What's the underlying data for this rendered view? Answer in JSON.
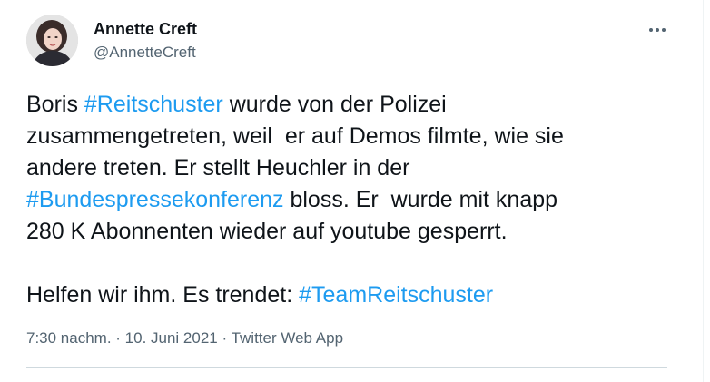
{
  "author": {
    "name": "Annette Creft",
    "handle": "@AnnetteCreft"
  },
  "tweet": {
    "line1": {
      "pre": "Boris ",
      "tag": "#Reitschuster",
      "post": " wurde von der Polizei"
    },
    "line2": "zusammengetreten, weil  er auf Demos filmte, wie sie",
    "line3": "andere treten. Er stellt Heuchler in der",
    "line4": {
      "tag": "#Bundespressekonferenz",
      "post": " bloss. Er  wurde mit knapp"
    },
    "line5": "280 K Abonnenten wieder auf youtube gesperrt.",
    "line6": {
      "pre": "Helfen wir ihm. Es trendet: ",
      "tag": "#TeamReitschuster"
    }
  },
  "meta": {
    "time": "7:30 nachm.",
    "sep1": " · ",
    "date": "10. Juni 2021",
    "sep2": " · ",
    "source": "Twitter Web App"
  },
  "icons": {
    "more": "more-options-icon"
  },
  "colors": {
    "link": "#1d9bf0",
    "text": "#0f1419",
    "muted": "#536471"
  }
}
